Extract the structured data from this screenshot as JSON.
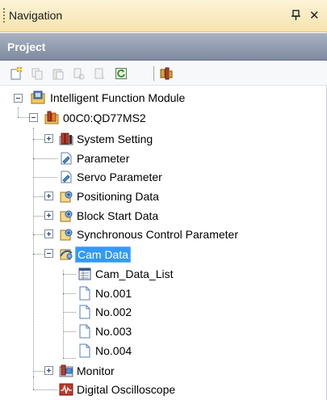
{
  "panel": {
    "title": "Navigation",
    "pin_glyph": "ᵖ",
    "close_glyph": "✕",
    "section": "Project"
  },
  "toolbar": {
    "icons": [
      "new-project-icon",
      "copy-icon",
      "paste-icon",
      "cut-icon",
      "properties-icon",
      "refresh-icon",
      "module-icon"
    ]
  },
  "tree": {
    "root": "Intelligent Function Module",
    "module": "00C0:QD77MS2",
    "items": [
      "System Setting",
      "Parameter",
      "Servo Parameter",
      "Positioning Data",
      "Block Start Data",
      "Synchronous Control Parameter",
      "Cam Data",
      "Monitor",
      "Digital Oscilloscope"
    ],
    "cam_children": [
      "Cam_Data_List",
      "No.001",
      "No.002",
      "No.003",
      "No.004"
    ],
    "selected": "Cam Data"
  }
}
